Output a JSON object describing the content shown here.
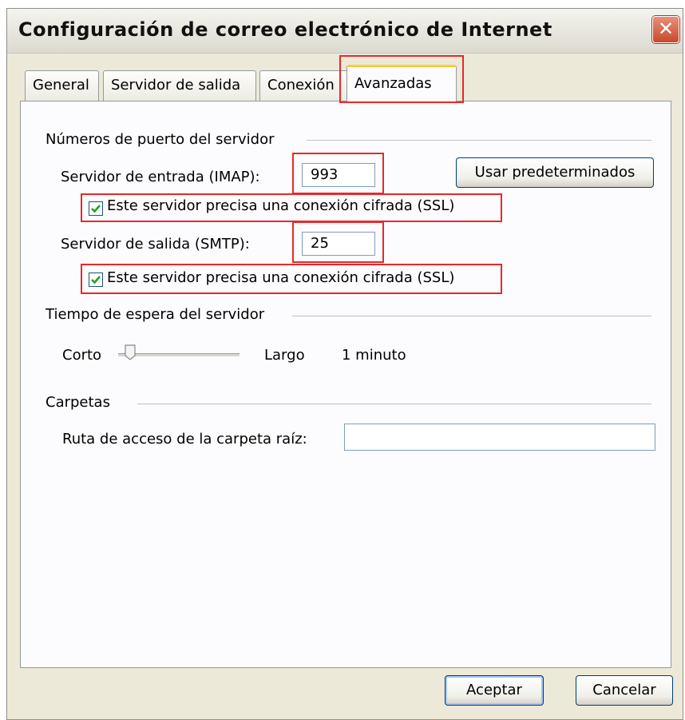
{
  "window": {
    "title": "Configuración de correo electrónico de Internet"
  },
  "tabs": [
    {
      "label": "General"
    },
    {
      "label": "Servidor de salida"
    },
    {
      "label": "Conexión"
    },
    {
      "label": "Avanzadas",
      "selected": true
    }
  ],
  "ports": {
    "heading": "Números de puerto del servidor",
    "incoming_label": "Servidor de entrada (IMAP):",
    "incoming_value": "993",
    "incoming_ssl_label": "Este servidor precisa una conexión cifrada (SSL)",
    "incoming_ssl_checked": true,
    "outgoing_label": "Servidor de salida (SMTP):",
    "outgoing_value": "25",
    "outgoing_ssl_label": "Este servidor precisa una conexión cifrada (SSL)",
    "outgoing_ssl_checked": true,
    "defaults_button": "Usar predeterminados"
  },
  "timeout": {
    "heading": "Tiempo de espera del servidor",
    "short_label": "Corto",
    "long_label": "Largo",
    "value_text": "1 minuto",
    "slider_position_fraction": 0.1
  },
  "folders": {
    "heading": "Carpetas",
    "root_path_label": "Ruta de acceso de la carpeta raíz:",
    "root_path_value": ""
  },
  "footer": {
    "ok_button": "Aceptar",
    "cancel_button": "Cancelar"
  },
  "colors": {
    "highlight": "#e8282a",
    "check": "#21a121",
    "active_tab_accent": "#ffc83c"
  }
}
